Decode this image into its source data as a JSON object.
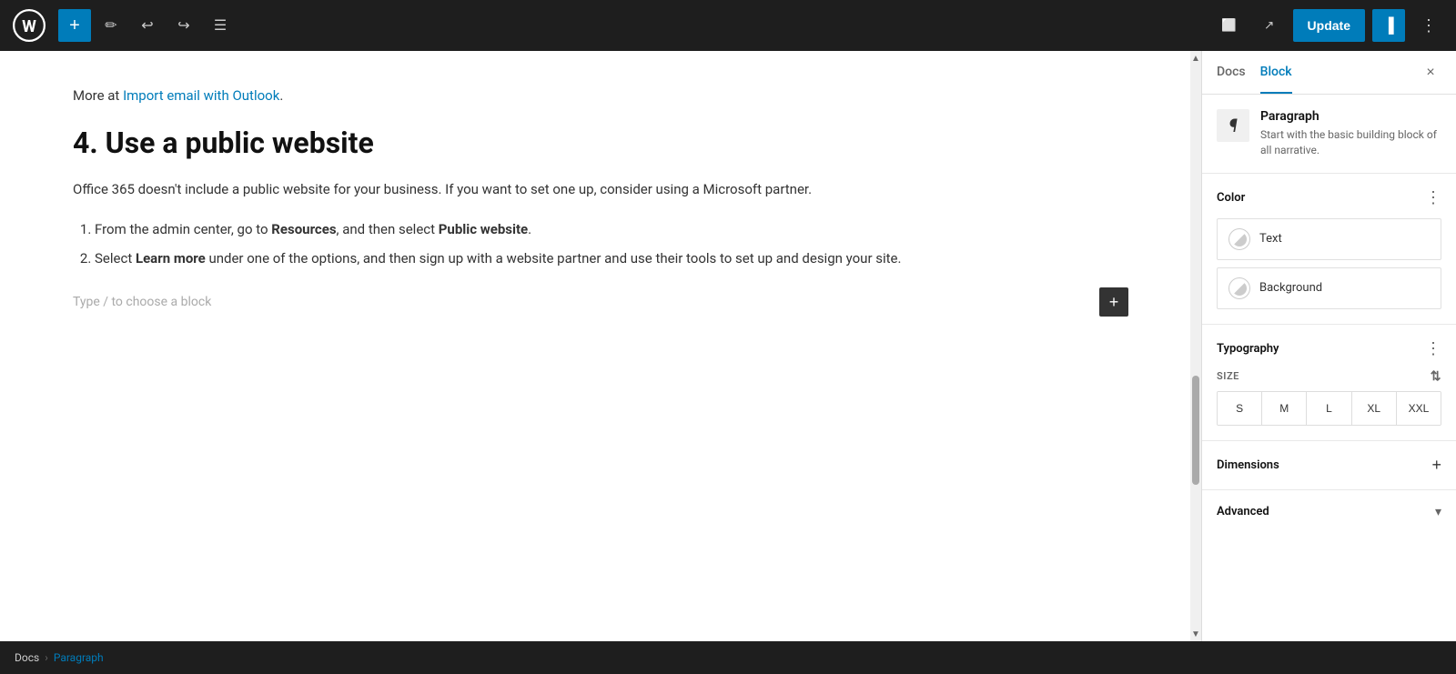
{
  "toolbar": {
    "add_label": "+",
    "update_label": "Update",
    "docs_tab": "Docs",
    "block_tab": "Block"
  },
  "editor": {
    "intro_text": "More at ",
    "intro_link": "Import email with Outlook",
    "intro_link_suffix": ".",
    "heading": "4. Use a public website",
    "paragraph": "Office 365 doesn't include a public website for your business. If you want to set one up, consider using a Microsoft partner.",
    "list_items": [
      {
        "text": "From the admin center, go to ",
        "bold_part": "Resources",
        "text2": ", and then select ",
        "bold_part2": "Public website",
        "text3": "."
      },
      {
        "text": "Select ",
        "bold_part": "Learn more",
        "text2": " under one of the options, and then sign up with a website partner and use their tools to set up and design your site."
      }
    ],
    "block_placeholder": "Type / to choose a block"
  },
  "sidebar": {
    "docs_tab": "Docs",
    "block_tab": "Block",
    "close_label": "×",
    "block_name": "Paragraph",
    "block_desc": "Start with the basic building block of all narrative.",
    "color_section": "Color",
    "text_label": "Text",
    "background_label": "Background",
    "typography_section": "Typography",
    "size_label": "SIZE",
    "size_options": [
      "S",
      "M",
      "L",
      "XL",
      "XXL"
    ],
    "dimensions_section": "Dimensions",
    "advanced_section": "Advanced"
  },
  "breadcrumb": {
    "items": [
      "Docs",
      "Paragraph"
    ]
  },
  "colors": {
    "accent": "#007cba"
  }
}
